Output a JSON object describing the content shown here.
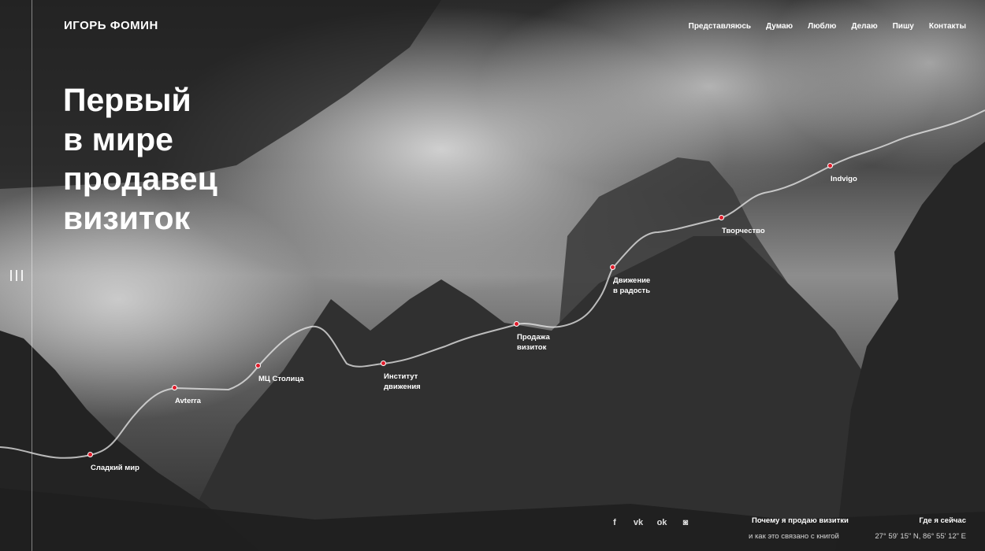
{
  "header": {
    "logo": "ИГОРЬ ФОМИН",
    "nav": [
      "Представляюсь",
      "Думаю",
      "Люблю",
      "Делаю",
      "Пишу",
      "Контакты"
    ]
  },
  "hero": {
    "headline_lines": [
      "Первый",
      "в мире",
      "продавец",
      "визиток"
    ]
  },
  "timeline": {
    "milestones": [
      {
        "lines": [
          "Сладкий мир"
        ]
      },
      {
        "lines": [
          "Avterra"
        ]
      },
      {
        "lines": [
          "МЦ Столица"
        ]
      },
      {
        "lines": [
          "Институт",
          "движения"
        ]
      },
      {
        "lines": [
          "Продажа",
          "визиток"
        ]
      },
      {
        "lines": [
          "Движение",
          "в радость"
        ]
      },
      {
        "lines": [
          "Творчество"
        ]
      },
      {
        "lines": [
          "Indvigo"
        ]
      }
    ],
    "dot_color": "#e01c2b"
  },
  "footer": {
    "socials": [
      {
        "icon": "facebook-icon",
        "glyph": "f"
      },
      {
        "icon": "vk-icon",
        "glyph": "vk"
      },
      {
        "icon": "odnoklassniki-icon",
        "glyph": "ok"
      },
      {
        "icon": "instagram-icon",
        "glyph": "◙"
      }
    ],
    "why_title": "Почему я продаю визитки",
    "why_subtitle": "и как это связано с книгой",
    "where_title": "Где я сейчас",
    "where_coords": "27° 59' 15\" N, 86° 55' 12\" E"
  }
}
